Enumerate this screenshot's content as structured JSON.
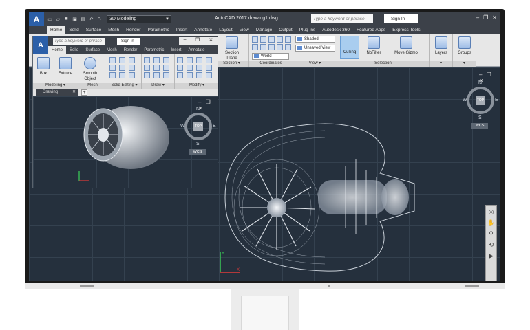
{
  "titlebar": {
    "app_logo": "A",
    "workspace": "3D Modeling",
    "title": "AutoCAD 2017  drawing1.dwg",
    "search_placeholder": "Type a keyword or phrase",
    "signin": "Sign In"
  },
  "ribbon_tabs": [
    "Home",
    "Solid",
    "Surface",
    "Mesh",
    "Render",
    "Parametric",
    "Insert",
    "Annotate",
    "Layout",
    "View",
    "Manage",
    "Output",
    "Plug-ins",
    "Autodesk 360",
    "Featured Apps",
    "Express Tools"
  ],
  "ribbon": {
    "section_plane": "Section Plane",
    "section_label": "Section ▾",
    "coordinates_label": "Coordinates",
    "view_label": "View ▾",
    "selection_label": "Selection",
    "visual_style": "Shaded",
    "view_preset": "Unsaved View",
    "ucs": "World",
    "culling": "Culling",
    "nofilter": "NoFilter",
    "move_gizmo": "Move Gizmo",
    "layers": "Layers",
    "groups": "Groups"
  },
  "viewcube": {
    "north": "N",
    "south": "S",
    "east": "E",
    "west": "W",
    "top": "TOP",
    "wcs": "WCS"
  },
  "inner_window": {
    "search_placeholder": "Type a keyword or phrase",
    "signin": "Sign In",
    "tabs": [
      "Home",
      "Solid",
      "Surface",
      "Mesh",
      "Render",
      "Parametric",
      "Insert",
      "Annotate"
    ],
    "buttons": {
      "box": "Box",
      "extrude": "Extrude",
      "smooth_object": "Smooth Object"
    },
    "panels": [
      "Modeling ▾",
      "Mesh",
      "Solid Editing ▾",
      "Draw ▾",
      "Modify ▾"
    ],
    "doc_tab": "Drawing",
    "doc_tab_close": "✕",
    "doc_add": "+"
  },
  "colors": {
    "viewport_bg": "#25303d",
    "grid_line": "#34414f",
    "ribbon_bg": "#e7e7e7",
    "titlebar_bg": "#3c4149",
    "autodesk_blue": "#2b5fa8"
  }
}
